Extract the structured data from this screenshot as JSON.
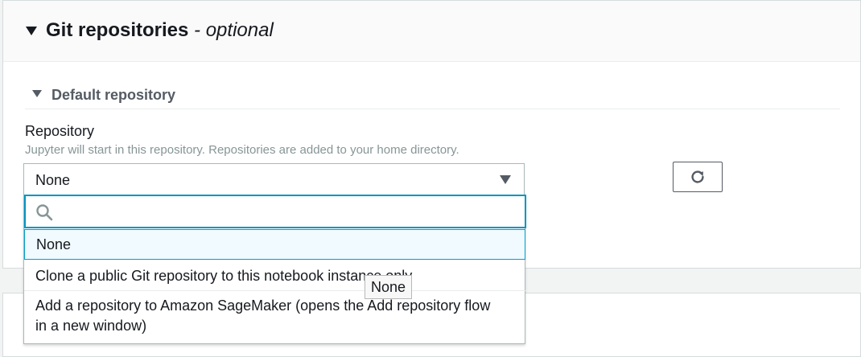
{
  "section": {
    "title": "Git repositories",
    "optional_label": "- optional"
  },
  "subsection": {
    "title": "Default repository"
  },
  "field": {
    "label": "Repository",
    "description": "Jupyter will start in this repository. Repositories are added to your home directory."
  },
  "select": {
    "value": "None",
    "search_placeholder": "",
    "options": [
      {
        "label": "None",
        "selected": true
      },
      {
        "label": "Clone a public Git repository to this notebook instance only",
        "selected": false
      },
      {
        "label": "Add a repository to Amazon SageMaker (opens the Add repository flow in a new window)",
        "selected": false
      }
    ]
  },
  "tooltip": {
    "text": "None"
  },
  "icons": {
    "section_toggle": "caret-down-icon",
    "refresh": "refresh-icon",
    "search": "search-icon"
  },
  "colors": {
    "focus_border": "#0095c5",
    "selected_bg": "#f1faff"
  }
}
